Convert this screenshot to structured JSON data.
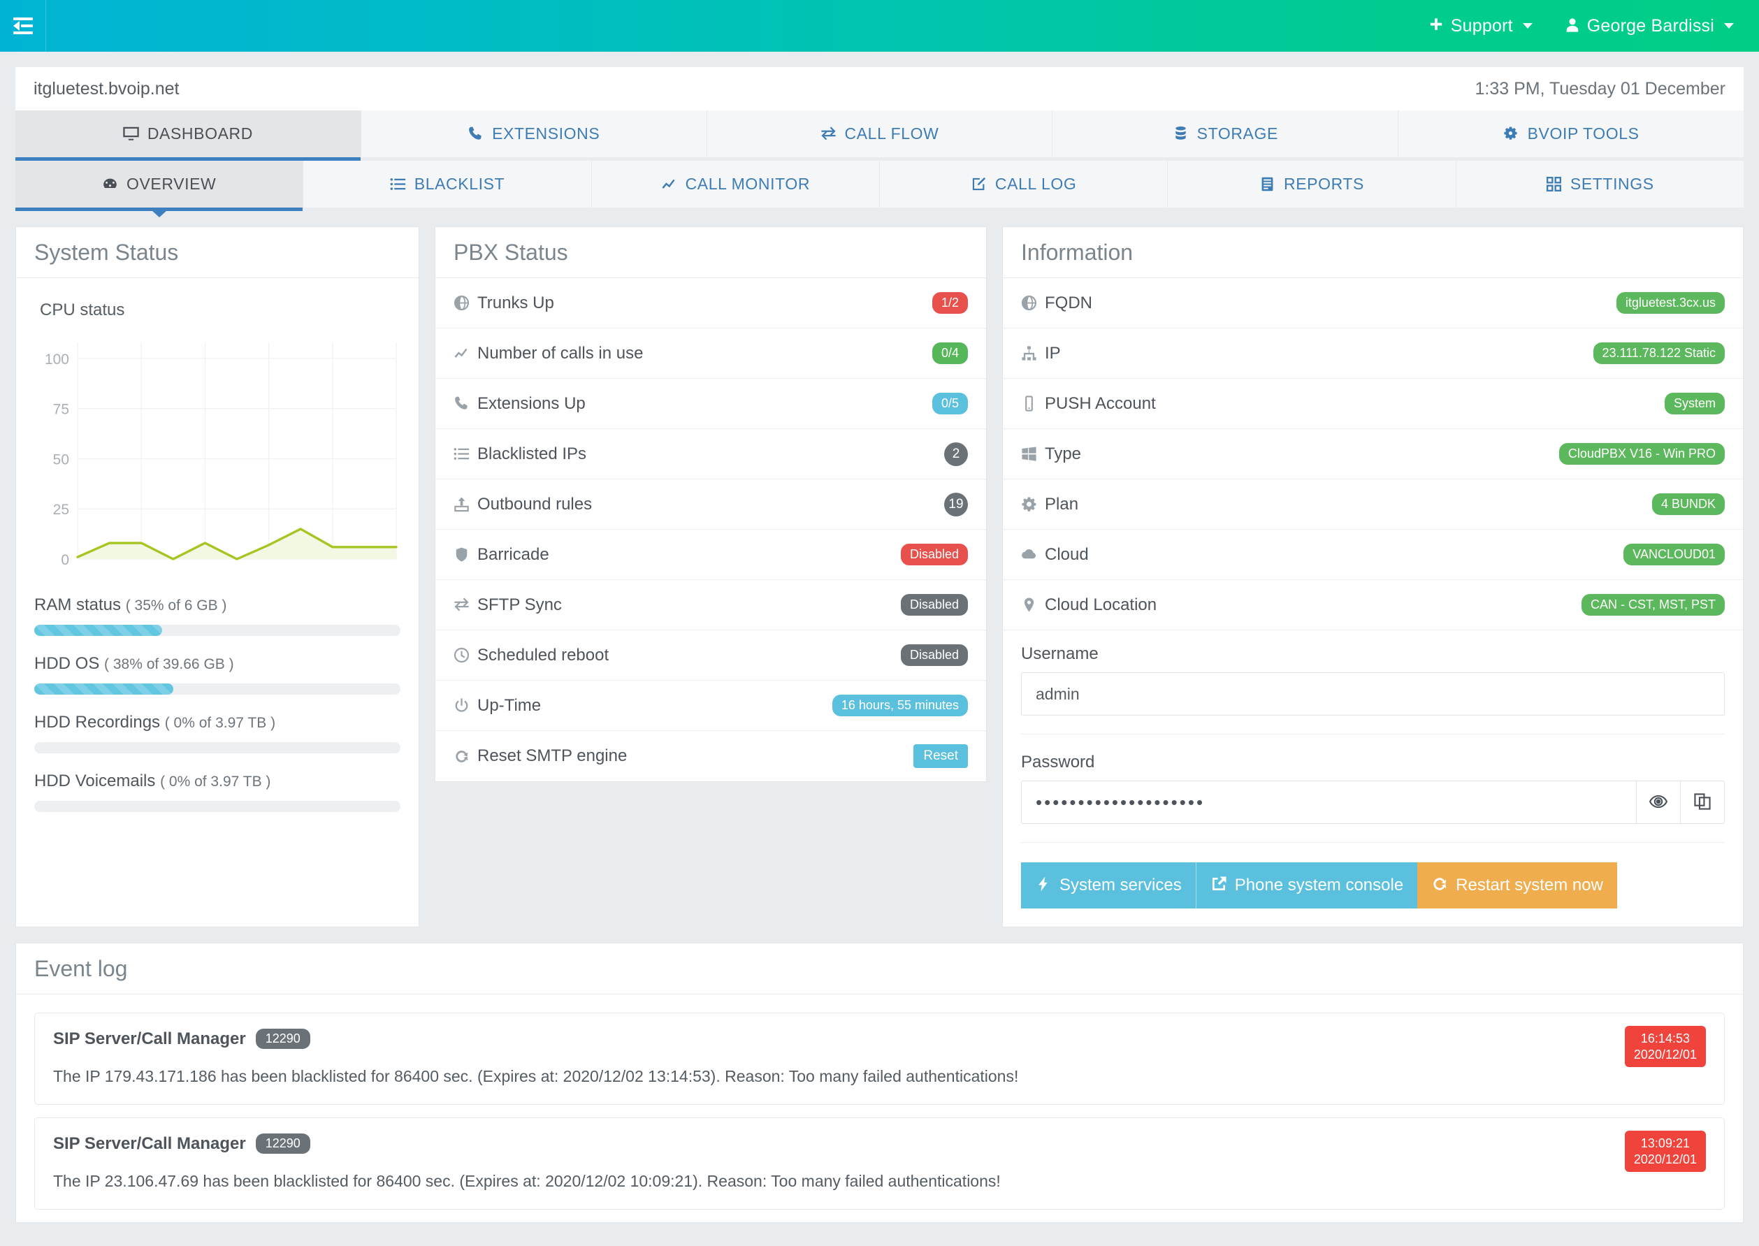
{
  "topbar": {
    "menu_icon": "collapse-sidebar-icon",
    "support_label": "Support",
    "support_icon": "plus-icon",
    "user_label": "George Bardissi",
    "user_icon": "user-icon"
  },
  "urlbar": {
    "host": "itgluetest.bvoip.net",
    "datetime": "1:33 PM, Tuesday 01 December"
  },
  "primary_tabs": [
    {
      "label": "DASHBOARD",
      "icon": "monitor-icon",
      "active": true
    },
    {
      "label": "EXTENSIONS",
      "icon": "phone-icon",
      "active": false
    },
    {
      "label": "CALL FLOW",
      "icon": "exchange-icon",
      "active": false
    },
    {
      "label": "STORAGE",
      "icon": "database-icon",
      "active": false
    },
    {
      "label": "BVOIP TOOLS",
      "icon": "gears-icon",
      "active": false
    }
  ],
  "secondary_tabs": [
    {
      "label": "OVERVIEW",
      "icon": "dashboard-icon",
      "active": true
    },
    {
      "label": "BLACKLIST",
      "icon": "list-icon",
      "active": false
    },
    {
      "label": "CALL MONITOR",
      "icon": "linechart-icon",
      "active": false
    },
    {
      "label": "CALL LOG",
      "icon": "edit-icon",
      "active": false
    },
    {
      "label": "REPORTS",
      "icon": "report-icon",
      "active": false
    },
    {
      "label": "SETTINGS",
      "icon": "grid-icon",
      "active": false
    }
  ],
  "system_status": {
    "title": "System Status",
    "cpu_label": "CPU status",
    "meters": [
      {
        "name": "RAM status",
        "detail": "( 35% of 6 GB )",
        "percent": 35
      },
      {
        "name": "HDD OS",
        "detail": "( 38% of 39.66 GB )",
        "percent": 38
      },
      {
        "name": "HDD Recordings",
        "detail": "( 0% of 3.97 TB )",
        "percent": 0
      },
      {
        "name": "HDD Voicemails",
        "detail": "( 0% of 3.97 TB )",
        "percent": 0
      }
    ]
  },
  "chart_data": {
    "type": "area",
    "title": "CPU status",
    "xlabel": "",
    "ylabel": "",
    "ylim": [
      0,
      108
    ],
    "yticks": [
      0,
      25,
      50,
      75,
      100
    ],
    "ytick_labels": [
      "0",
      "25",
      "50",
      "75",
      "100"
    ],
    "grid": true,
    "x": [
      0,
      1,
      2,
      3,
      4,
      5,
      6,
      7,
      8,
      9,
      10
    ],
    "values": [
      1,
      8,
      8,
      0,
      8,
      0,
      7,
      15,
      6,
      6,
      6
    ],
    "line_color": "#a5c520",
    "fill_color": "#f3f8e4",
    "legend": "none"
  },
  "pbx_status": {
    "title": "PBX Status",
    "rows": [
      {
        "label": "Trunks Up",
        "icon": "globe-icon",
        "value": "1/2",
        "style": "red"
      },
      {
        "label": "Number of calls in use",
        "icon": "linechart-icon",
        "value": "0/4",
        "style": "green"
      },
      {
        "label": "Extensions Up",
        "icon": "phone-icon",
        "value": "0/5",
        "style": "blue"
      },
      {
        "label": "Blacklisted IPs",
        "icon": "list-icon",
        "value": "2",
        "style": "circle-grey"
      },
      {
        "label": "Outbound rules",
        "icon": "upload-icon",
        "value": "19",
        "style": "circle-grey"
      },
      {
        "label": "Barricade",
        "icon": "shield-icon",
        "value": "Disabled",
        "style": "red"
      },
      {
        "label": "SFTP Sync",
        "icon": "exchange-icon",
        "value": "Disabled",
        "style": "grey"
      },
      {
        "label": "Scheduled reboot",
        "icon": "clock-icon",
        "value": "Disabled",
        "style": "grey"
      },
      {
        "label": "Up-Time",
        "icon": "power-icon",
        "value": "16 hours, 55 minutes",
        "style": "blue"
      },
      {
        "label": "Reset SMTP engine",
        "icon": "refresh-icon",
        "value": "Reset",
        "style": "sq-blue"
      }
    ]
  },
  "information": {
    "title": "Information",
    "rows": [
      {
        "label": "FQDN",
        "icon": "globe-icon",
        "value": "itgluetest.3cx.us"
      },
      {
        "label": "IP",
        "icon": "sitemap-icon",
        "value": "23.111.78.122 Static"
      },
      {
        "label": "PUSH Account",
        "icon": "mobile-icon",
        "value": "System"
      },
      {
        "label": "Type",
        "icon": "windows-icon",
        "value": "CloudPBX V16 - Win PRO"
      },
      {
        "label": "Plan",
        "icon": "gear-icon",
        "value": "4 BUNDK"
      },
      {
        "label": "Cloud",
        "icon": "cloud-icon",
        "value": "VANCLOUD01"
      },
      {
        "label": "Cloud Location",
        "icon": "map-pin-icon",
        "value": "CAN - CST, MST, PST"
      }
    ],
    "username_label": "Username",
    "username_value": "admin",
    "password_label": "Password",
    "password_value": "••••••••••••••••••••",
    "reveal_icon": "eye-icon",
    "copy_icon": "copy-icon",
    "buttons": [
      {
        "label": "System services",
        "icon": "bolt-icon",
        "style": "cyan"
      },
      {
        "label": "Phone system console",
        "icon": "external-link-icon",
        "style": "cyan2"
      },
      {
        "label": "Restart system now",
        "icon": "refresh-icon",
        "style": "orange"
      }
    ]
  },
  "event_log": {
    "title": "Event log",
    "items": [
      {
        "source": "SIP Server/Call Manager",
        "code": "12290",
        "message": "The IP 179.43.171.186 has been blacklisted for 86400 sec. (Expires at: 2020/12/02 13:14:53). Reason: Too many failed authentications!",
        "time": "16:14:53",
        "date": "2020/12/01"
      },
      {
        "source": "SIP Server/Call Manager",
        "code": "12290",
        "message": "The IP 23.106.47.69 has been blacklisted for 86400 sec. (Expires at: 2020/12/02 10:09:21). Reason: Too many failed authentications!",
        "time": "13:09:21",
        "date": "2020/12/01"
      }
    ]
  },
  "colors": {
    "header_start": "#00b3d4",
    "header_end": "#00ce86",
    "tab_accent": "#3e7fbf",
    "tab_link": "#3d7cb5",
    "chart_line": "#a5c520",
    "meter_fill": "#63c6e0",
    "badge_red": "#e8514b",
    "badge_green": "#56b65a",
    "badge_blue": "#5bc0de",
    "badge_grey": "#6a7278",
    "btn_orange": "#f0ad4e",
    "event_time": "#f0433c"
  }
}
